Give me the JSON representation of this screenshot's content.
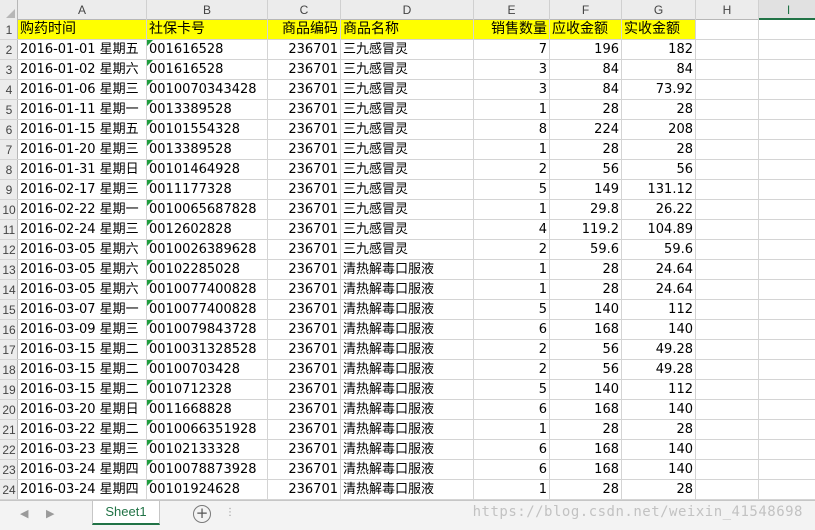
{
  "columns": [
    {
      "id": "A",
      "label": "A"
    },
    {
      "id": "B",
      "label": "B"
    },
    {
      "id": "C",
      "label": "C"
    },
    {
      "id": "D",
      "label": "D"
    },
    {
      "id": "E",
      "label": "E"
    },
    {
      "id": "F",
      "label": "F"
    },
    {
      "id": "G",
      "label": "G"
    },
    {
      "id": "H",
      "label": "H"
    },
    {
      "id": "I",
      "label": "I"
    }
  ],
  "selected_column": "I",
  "headers": [
    "购药时间",
    "社保卡号",
    "商品编码",
    "商品名称",
    "销售数量",
    "应收金额",
    "实收金额",
    "",
    ""
  ],
  "rows": [
    {
      "num": "2",
      "cells": [
        "2016-01-01 星期五",
        "001616528",
        "236701",
        "三九感冒灵",
        "7",
        "196",
        "182",
        "",
        ""
      ]
    },
    {
      "num": "3",
      "cells": [
        "2016-01-02 星期六",
        "001616528",
        "236701",
        "三九感冒灵",
        "3",
        "84",
        "84",
        "",
        ""
      ]
    },
    {
      "num": "4",
      "cells": [
        "2016-01-06 星期三",
        "0010070343428",
        "236701",
        "三九感冒灵",
        "3",
        "84",
        "73.92",
        "",
        ""
      ]
    },
    {
      "num": "5",
      "cells": [
        "2016-01-11 星期一",
        "0013389528",
        "236701",
        "三九感冒灵",
        "1",
        "28",
        "28",
        "",
        ""
      ]
    },
    {
      "num": "6",
      "cells": [
        "2016-01-15 星期五",
        "00101554328",
        "236701",
        "三九感冒灵",
        "8",
        "224",
        "208",
        "",
        ""
      ]
    },
    {
      "num": "7",
      "cells": [
        "2016-01-20 星期三",
        "0013389528",
        "236701",
        "三九感冒灵",
        "1",
        "28",
        "28",
        "",
        ""
      ]
    },
    {
      "num": "8",
      "cells": [
        "2016-01-31 星期日",
        "00101464928",
        "236701",
        "三九感冒灵",
        "2",
        "56",
        "56",
        "",
        ""
      ]
    },
    {
      "num": "9",
      "cells": [
        "2016-02-17 星期三",
        "0011177328",
        "236701",
        "三九感冒灵",
        "5",
        "149",
        "131.12",
        "",
        ""
      ]
    },
    {
      "num": "10",
      "cells": [
        "2016-02-22 星期一",
        "0010065687828",
        "236701",
        "三九感冒灵",
        "1",
        "29.8",
        "26.22",
        "",
        ""
      ]
    },
    {
      "num": "11",
      "cells": [
        "2016-02-24 星期三",
        "0012602828",
        "236701",
        "三九感冒灵",
        "4",
        "119.2",
        "104.89",
        "",
        ""
      ]
    },
    {
      "num": "12",
      "cells": [
        "2016-03-05 星期六",
        "0010026389628",
        "236701",
        "三九感冒灵",
        "2",
        "59.6",
        "59.6",
        "",
        ""
      ]
    },
    {
      "num": "13",
      "cells": [
        "2016-03-05 星期六",
        "00102285028",
        "236701",
        "清热解毒口服液",
        "1",
        "28",
        "24.64",
        "",
        ""
      ]
    },
    {
      "num": "14",
      "cells": [
        "2016-03-05 星期六",
        "0010077400828",
        "236701",
        "清热解毒口服液",
        "1",
        "28",
        "24.64",
        "",
        ""
      ]
    },
    {
      "num": "15",
      "cells": [
        "2016-03-07 星期一",
        "0010077400828",
        "236701",
        "清热解毒口服液",
        "5",
        "140",
        "112",
        "",
        ""
      ]
    },
    {
      "num": "16",
      "cells": [
        "2016-03-09 星期三",
        "0010079843728",
        "236701",
        "清热解毒口服液",
        "6",
        "168",
        "140",
        "",
        ""
      ]
    },
    {
      "num": "17",
      "cells": [
        "2016-03-15 星期二",
        "0010031328528",
        "236701",
        "清热解毒口服液",
        "2",
        "56",
        "49.28",
        "",
        ""
      ]
    },
    {
      "num": "18",
      "cells": [
        "2016-03-15 星期二",
        "00100703428",
        "236701",
        "清热解毒口服液",
        "2",
        "56",
        "49.28",
        "",
        ""
      ]
    },
    {
      "num": "19",
      "cells": [
        "2016-03-15 星期二",
        "0010712328",
        "236701",
        "清热解毒口服液",
        "5",
        "140",
        "112",
        "",
        ""
      ]
    },
    {
      "num": "20",
      "cells": [
        "2016-03-20 星期日",
        "0011668828",
        "236701",
        "清热解毒口服液",
        "6",
        "168",
        "140",
        "",
        ""
      ]
    },
    {
      "num": "21",
      "cells": [
        "2016-03-22 星期二",
        "0010066351928",
        "236701",
        "清热解毒口服液",
        "1",
        "28",
        "28",
        "",
        ""
      ]
    },
    {
      "num": "22",
      "cells": [
        "2016-03-23 星期三",
        "00102133328",
        "236701",
        "清热解毒口服液",
        "6",
        "168",
        "140",
        "",
        ""
      ]
    },
    {
      "num": "23",
      "cells": [
        "2016-03-24 星期四",
        "0010078873928",
        "236701",
        "清热解毒口服液",
        "6",
        "168",
        "140",
        "",
        ""
      ]
    },
    {
      "num": "24",
      "cells": [
        "2016-03-24 星期四",
        "00101924628",
        "236701",
        "清热解毒口服液",
        "1",
        "28",
        "28",
        "",
        ""
      ]
    }
  ],
  "header_row_num": "1",
  "header_fill_color": "#ffff00",
  "text_flag_color": "#1e9e3e",
  "accent_color": "#217346",
  "sheet_tabs": [
    {
      "label": "Sheet1",
      "active": true
    }
  ],
  "nav": {
    "prev_icon": "◀",
    "next_icon": "▶",
    "add_sheet_icon": "⊕",
    "add_sheet_symbol": "+",
    "more_icon": "⋮"
  },
  "watermark": "https://blog.csdn.net/weixin_41548698"
}
